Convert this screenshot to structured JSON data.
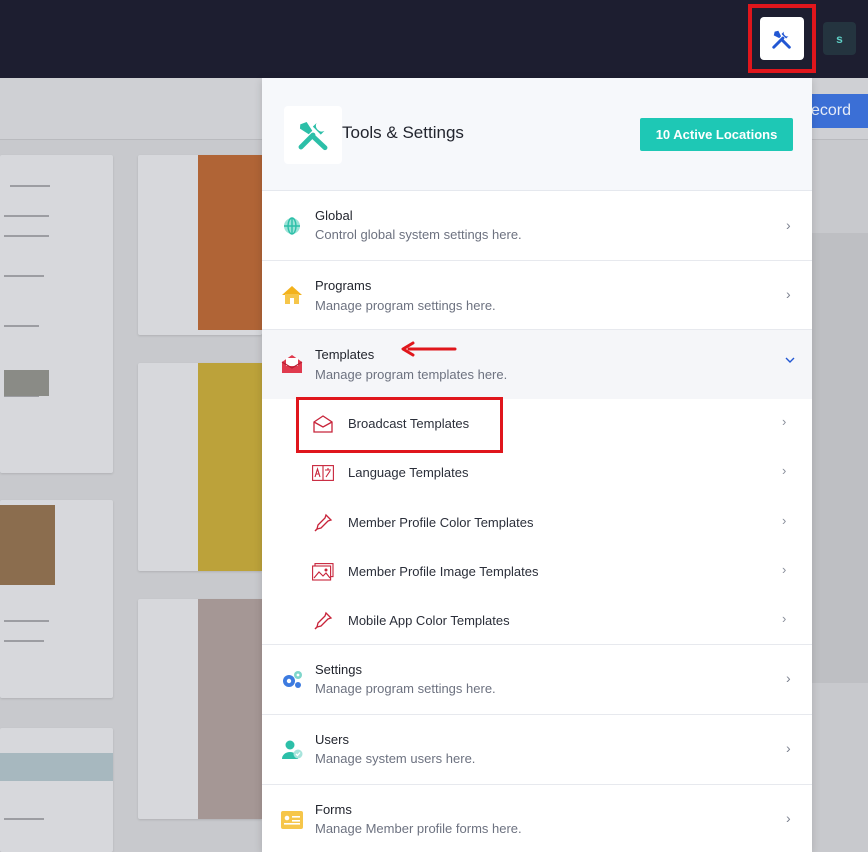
{
  "topbar": {
    "avatar_initial": "s"
  },
  "background": {
    "record_button": "ecord"
  },
  "panel": {
    "title": "Tools & Settings",
    "locations_button": "10 Active Locations",
    "sections": [
      {
        "id": "global",
        "title": "Global",
        "description": "Control global system settings here."
      },
      {
        "id": "programs",
        "title": "Programs",
        "description": "Manage program settings here."
      },
      {
        "id": "templates",
        "title": "Templates",
        "description": "Manage program templates here."
      },
      {
        "id": "settings",
        "title": "Settings",
        "description": "Manage program settings here."
      },
      {
        "id": "users",
        "title": "Users",
        "description": "Manage system users here."
      },
      {
        "id": "forms",
        "title": "Forms",
        "description": "Manage Member profile forms here."
      }
    ],
    "template_items": [
      {
        "label": "Broadcast Templates",
        "icon": "envelope-open-icon"
      },
      {
        "label": "Language Templates",
        "icon": "translate-icon"
      },
      {
        "label": "Member Profile Color Templates",
        "icon": "eyedropper-icon"
      },
      {
        "label": "Member Profile Image Templates",
        "icon": "image-icon"
      },
      {
        "label": "Mobile App Color Templates",
        "icon": "eyedropper-icon"
      }
    ]
  },
  "colors": {
    "accent": "#1ec8b5",
    "highlight": "#e0161c",
    "topbar": "#1d1e30",
    "template_icon": "#c8243a"
  }
}
